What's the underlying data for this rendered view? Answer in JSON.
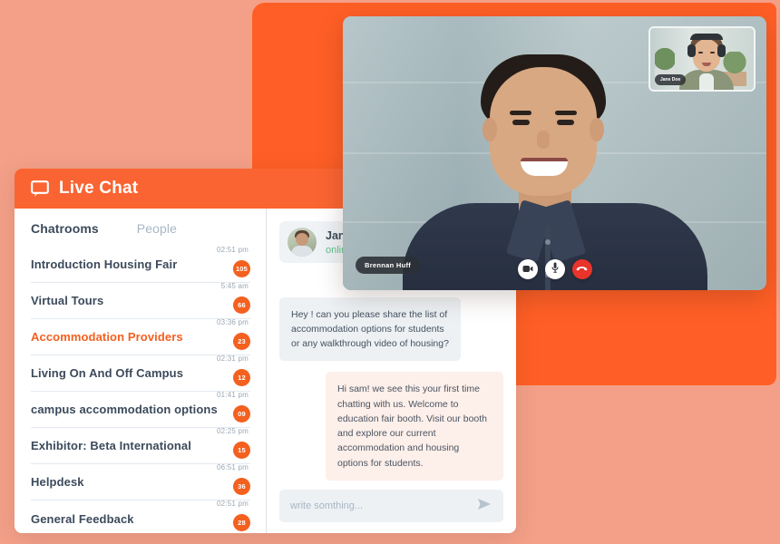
{
  "header": {
    "title": "Live Chat",
    "icon": "speech-bubble-icon"
  },
  "tabs": [
    {
      "label": "Chatrooms",
      "active": true
    },
    {
      "label": "People",
      "active": false
    }
  ],
  "chatrooms": [
    {
      "name": "Introduction Housing Fair",
      "time": "02:51 pm",
      "badge": "105",
      "active": false
    },
    {
      "name": "Virtual Tours",
      "time": "5:45 am",
      "badge": "66",
      "active": false
    },
    {
      "name": "Accommodation Providers",
      "time": "03:36 pm",
      "badge": "23",
      "active": true
    },
    {
      "name": "Living On And Off Campus",
      "time": "02:31 pm",
      "badge": "12",
      "active": false
    },
    {
      "name": "campus accommodation options",
      "time": "01:41 pm",
      "badge": "09",
      "active": false
    },
    {
      "name": "Exhibitor: Beta International",
      "time": "02:25 pm",
      "badge": "15",
      "active": false
    },
    {
      "name": "Helpdesk",
      "time": "06:51 pm",
      "badge": "36",
      "active": false
    },
    {
      "name": "General Feedback",
      "time": "02:51 pm",
      "badge": "28",
      "active": false
    }
  ],
  "peer": {
    "name": "Janny",
    "status": "online"
  },
  "messages": [
    {
      "direction": "incoming",
      "text": "Hey ! can you please share the list of accommodation options for students or any walkthrough video of housing?"
    },
    {
      "direction": "outgoing",
      "text": "Hi sam! we see this your first time chatting with us. Welcome to education fair booth. Visit our booth and explore our current accommodation and housing options for students."
    }
  ],
  "composer": {
    "placeholder": "write somthing...",
    "value": "",
    "send_icon": "send-arrow-icon"
  },
  "video_call": {
    "main_participant": "Brennan Huff",
    "pip_participant": "Jane Doe",
    "controls": [
      {
        "name": "camera-toggle",
        "icon": "video-camera-icon"
      },
      {
        "name": "microphone-toggle",
        "icon": "microphone-icon"
      },
      {
        "name": "end-call",
        "icon": "phone-hangup-icon"
      }
    ]
  },
  "colors": {
    "brand_orange": "#FA6432",
    "panel_orange": "#FF5F26",
    "background_salmon": "#F4A088",
    "badge": "#F4601F",
    "online_green": "#5BC48A",
    "end_call_red": "#E8342B",
    "text_dark": "#3C4A5B",
    "bubble_in": "#EDF1F4",
    "bubble_out": "#FDEFE9"
  }
}
